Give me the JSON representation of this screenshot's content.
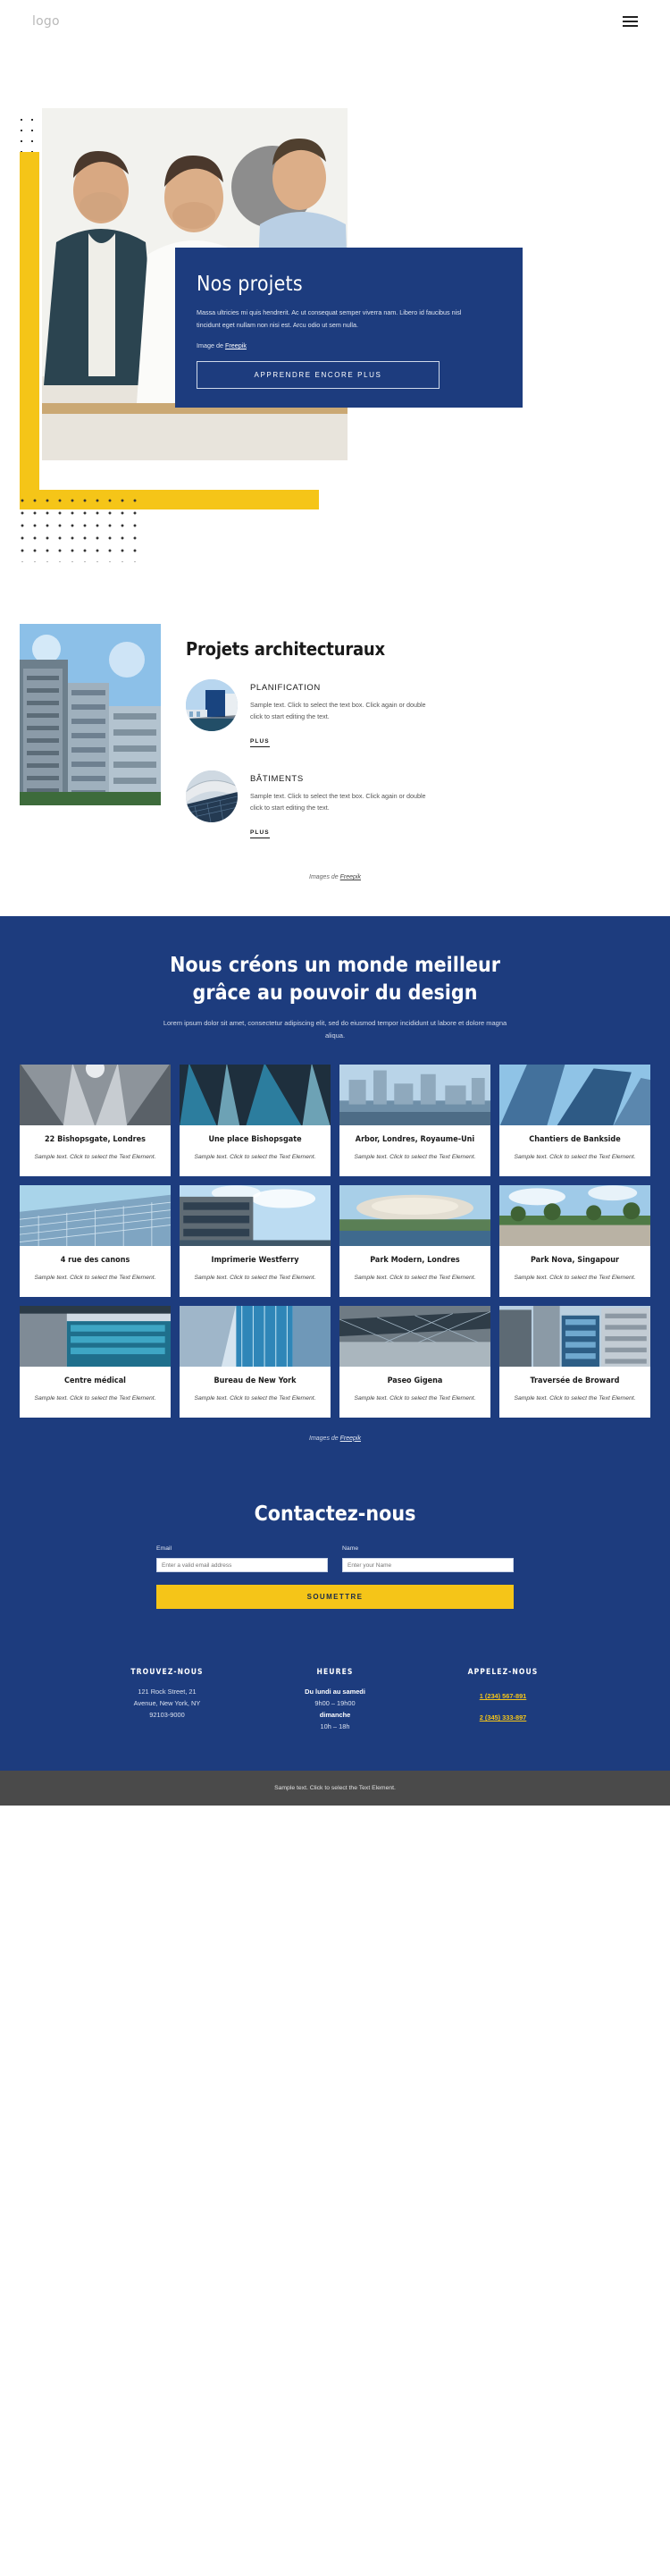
{
  "header": {
    "logo": "logo",
    "menu_icon": "hamburger-menu-icon"
  },
  "hero": {
    "title": "Nos projets",
    "paragraph": "Massa ultricies mi quis hendrerit. Ac ut consequat semper viverra nam. Libero id faucibus nisl tincidunt eget nullam non nisi est. Arcu odio ut sem nulla.",
    "credit_prefix": "Image de ",
    "credit_link": "Freepik",
    "cta": "APPRENDRE ENCORE PLUS"
  },
  "architecture": {
    "title": "Projets architecturaux",
    "credit_prefix": "Images de ",
    "credit_link": "Freepik",
    "features": [
      {
        "title": "PLANIFICATION",
        "text": "Sample text. Click to select the text box. Click again or double click to start editing the text.",
        "link": "PLUS"
      },
      {
        "title": "BÂTIMENTS",
        "text": "Sample text. Click to select the text box. Click again or double click to start editing the text.",
        "link": "PLUS"
      }
    ]
  },
  "portfolio": {
    "heading_line1": "Nous créons un monde meilleur",
    "heading_line2": "grâce au pouvoir du design",
    "subtext": "Lorem ipsum dolor sit amet, consectetur adipiscing elit, sed do eiusmod tempor incididunt ut labore et dolore magna aliqua.",
    "credit_prefix": "Images de ",
    "credit_link": "Freepik",
    "cards": [
      {
        "title": "22 Bishopsgate, Londres",
        "text": "Sample text. Click to select the Text Element."
      },
      {
        "title": "Une place Bishopsgate",
        "text": "Sample text. Click to select the Text Element."
      },
      {
        "title": "Arbor, Londres, Royaume-Uni",
        "text": "Sample text. Click to select the Text Element."
      },
      {
        "title": "Chantiers de Bankside",
        "text": "Sample text. Click to select the Text Element."
      },
      {
        "title": "4 rue des canons",
        "text": "Sample text. Click to select the Text Element."
      },
      {
        "title": "Imprimerie Westferry",
        "text": "Sample text. Click to select the Text Element."
      },
      {
        "title": "Park Modern, Londres",
        "text": "Sample text. Click to select the Text Element."
      },
      {
        "title": "Park Nova, Singapour",
        "text": "Sample text. Click to select the Text Element."
      },
      {
        "title": "Centre médical",
        "text": "Sample text. Click to select the Text Element."
      },
      {
        "title": "Bureau de New York",
        "text": "Sample text. Click to select the Text Element."
      },
      {
        "title": "Paseo Gigena",
        "text": "Sample text. Click to select the Text Element."
      },
      {
        "title": "Traversée de Broward",
        "text": "Sample text. Click to select the Text Element."
      }
    ]
  },
  "contact": {
    "title": "Contactez-nous",
    "email_label": "Email",
    "email_placeholder": "Enter a valid email address",
    "name_label": "Name",
    "name_placeholder": "Enter your Name",
    "submit": "SOUMETTRE"
  },
  "footer": {
    "columns": [
      {
        "heading": "TROUVEZ-NOUS",
        "lines": [
          "121 Rock Street, 21",
          "Avenue, New York, NY",
          "92103-9000"
        ]
      },
      {
        "heading": "HEURES",
        "lines": [
          "Du lundi au samedi",
          "9h00 – 19h00",
          "dimanche",
          "10h – 18h"
        ]
      },
      {
        "heading": "APPELEZ-NOUS",
        "phones": [
          "1 (234) 567-891",
          "2 (345) 333-897"
        ]
      }
    ],
    "bottom_text": "Sample text. Click to select the Text Element."
  },
  "colors": {
    "brand_blue": "#1D3C7E",
    "accent_yellow": "#F5C518",
    "footer_gray": "#4a4a4a"
  }
}
